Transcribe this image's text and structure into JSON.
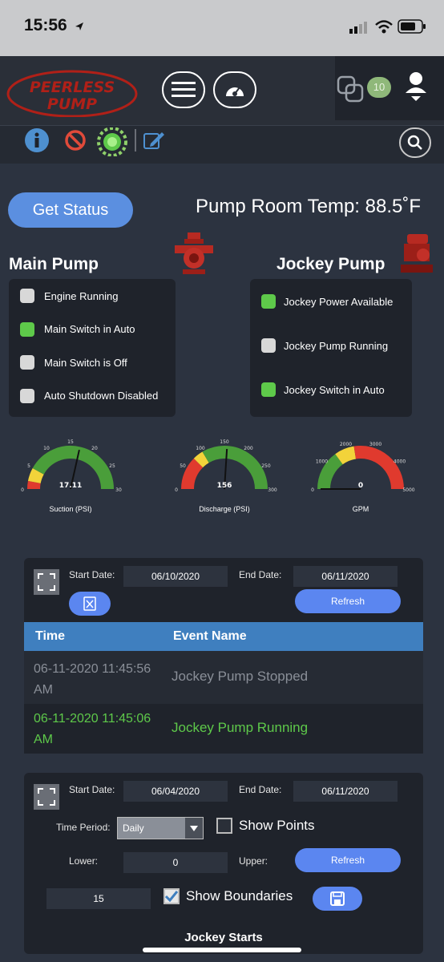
{
  "status_bar": {
    "time": "15:56"
  },
  "nav": {
    "brand_line1": "PEERLESS",
    "brand_line2": "PUMP",
    "badge_count": "10"
  },
  "header": {
    "get_status_label": "Get Status",
    "temp_label": "Pump Room Temp:",
    "temp_value": "88.5˚F"
  },
  "main_pump": {
    "title": "Main Pump",
    "items": [
      {
        "label": "Engine Running",
        "on": false
      },
      {
        "label": "Main Switch in Auto",
        "on": true
      },
      {
        "label": "Main Switch is Off",
        "on": false
      },
      {
        "label": "Auto Shutdown Disabled",
        "on": false
      }
    ]
  },
  "jockey_pump": {
    "title": "Jockey Pump",
    "items": [
      {
        "label": "Jockey Power Available",
        "on": true
      },
      {
        "label": "Jockey Pump Running",
        "on": false
      },
      {
        "label": "Jockey Switch in Auto",
        "on": true
      }
    ]
  },
  "gauges": [
    {
      "label": "Suction (PSI)",
      "value": "17.11",
      "ticks": [
        "0",
        "5",
        "10",
        "15",
        "20",
        "25",
        "30"
      ]
    },
    {
      "label": "Discharge (PSI)",
      "value": "156",
      "ticks": [
        "0",
        "50",
        "100",
        "150",
        "200",
        "250",
        "300"
      ]
    },
    {
      "label": "GPM",
      "value": "0",
      "ticks": [
        "0",
        "1000",
        "2000",
        "3000",
        "4000",
        "5000"
      ]
    }
  ],
  "events_panel": {
    "start_label": "Start Date:",
    "start_value": "06/10/2020",
    "end_label": "End Date:",
    "end_value": "06/11/2020",
    "refresh_label": "Refresh",
    "col_time": "Time",
    "col_event": "Event Name",
    "rows": [
      {
        "time_line1": "06-11-2020 11:45:56",
        "time_line2": "AM",
        "event": "Jockey Pump Stopped"
      },
      {
        "time_line1": "06-11-2020 11:45:06",
        "time_line2": "AM",
        "event": "Jockey Pump Running"
      }
    ]
  },
  "starts_panel": {
    "start_label": "Start Date:",
    "start_value": "06/04/2020",
    "end_label": "End Date:",
    "end_value": "06/11/2020",
    "time_period_label": "Time Period:",
    "time_period_value": "Daily",
    "show_points_label": "Show Points",
    "lower_label": "Lower:",
    "lower_value": "0",
    "upper_label": "Upper:",
    "refresh_label": "Refresh",
    "count_value": "15",
    "show_boundaries_label": "Show Boundaries",
    "chart_title": "Jockey Starts"
  },
  "colors": {
    "green": "#5ec94a",
    "red": "#e03a2e",
    "yellow": "#f2d33a",
    "gauge_green": "#4a9e3a",
    "accent_blue": "#5b86f0"
  }
}
